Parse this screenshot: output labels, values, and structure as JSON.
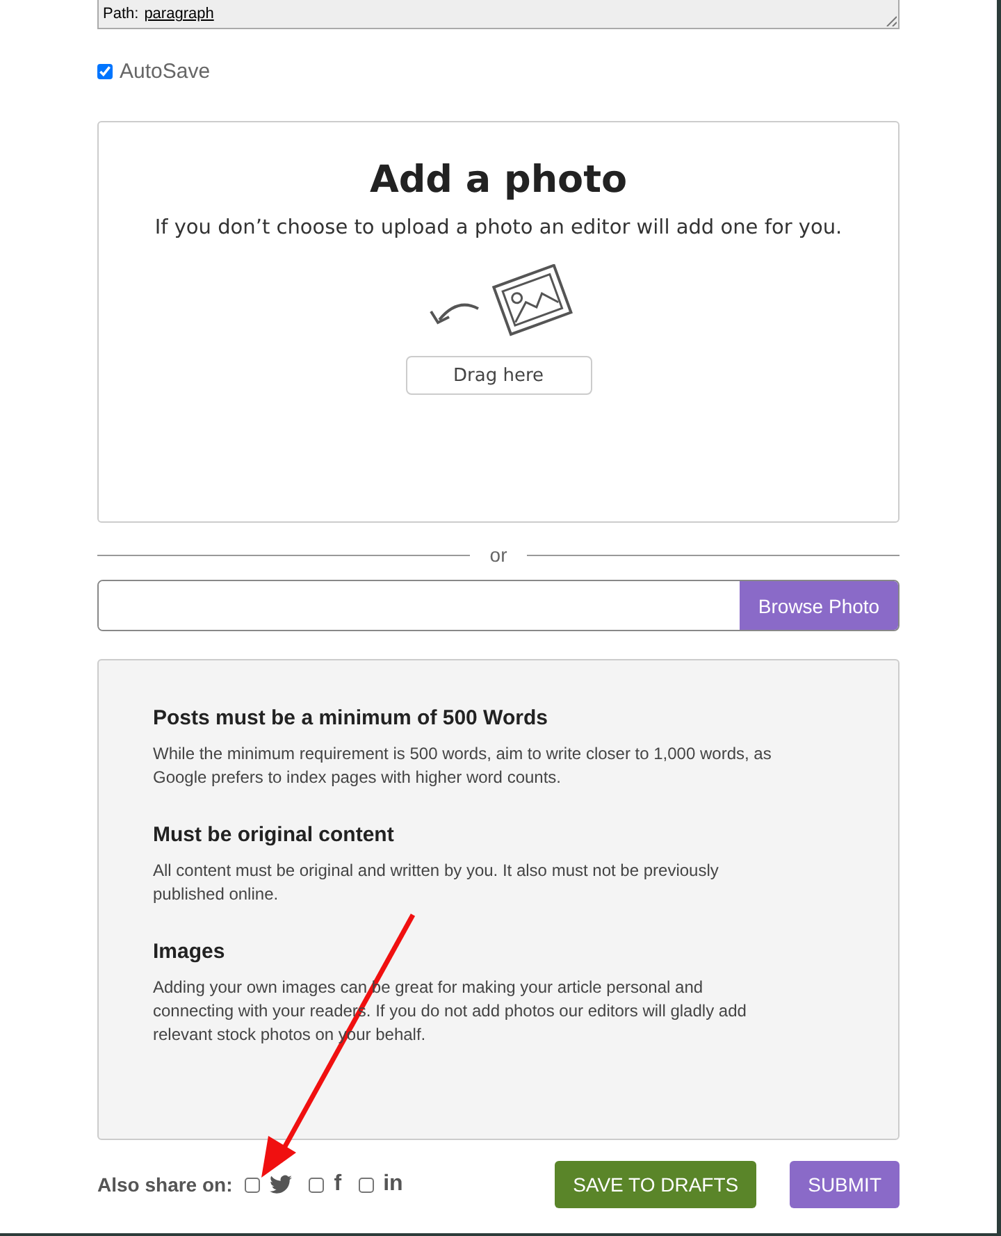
{
  "editor_status": {
    "label": "Path:",
    "path": "paragraph"
  },
  "autosave": {
    "label": "AutoSave",
    "checked": true
  },
  "photo_upload": {
    "title": "Add a photo",
    "subtitle": "If you don’t choose to upload a photo an editor will add one for you.",
    "drop_button": "Drag here"
  },
  "divider": "or",
  "file_input": {
    "button": "Browse Photo"
  },
  "guidelines": [
    {
      "heading": "Posts must be a minimum of 500 Words",
      "text": "While the minimum requirement is 500 words, aim to write closer to 1,000 words, as Google prefers to index pages with higher word counts."
    },
    {
      "heading": "Must be original content",
      "text": "All content must be original and written by you. It also must not be previously published online."
    },
    {
      "heading": "Images",
      "text": "Adding your own images can be great for making your article personal and connecting with your readers. If you do not add photos our editors will gladly add relevant stock photos on your behalf."
    }
  ],
  "share": {
    "label": "Also share on:",
    "networks": [
      {
        "kind": "twitter",
        "checked": false
      },
      {
        "kind": "facebook",
        "glyph": "f",
        "checked": false
      },
      {
        "kind": "linkedin",
        "glyph": "in",
        "checked": false
      }
    ]
  },
  "actions": [
    {
      "kind": "drafts",
      "label": "SAVE TO DRAFTS"
    },
    {
      "kind": "submit",
      "label": "SUBMIT"
    }
  ]
}
